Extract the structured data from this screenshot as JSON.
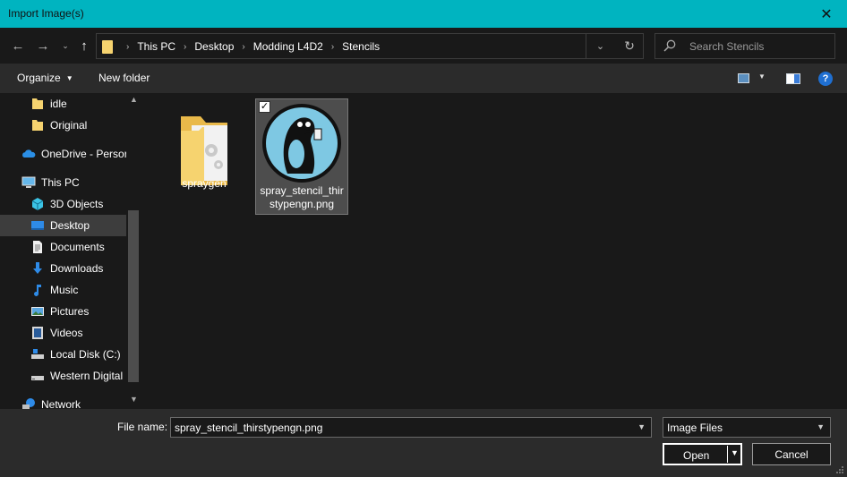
{
  "window": {
    "title": "Import Image(s)"
  },
  "address": {
    "crumbs": [
      "This PC",
      "Desktop",
      "Modding L4D2",
      "Stencils"
    ]
  },
  "search": {
    "placeholder": "Search Stencils"
  },
  "toolbar": {
    "organize_label": "Organize",
    "new_folder_label": "New folder"
  },
  "sidebar": {
    "items": [
      {
        "label": "idle",
        "icon": "folder-icon"
      },
      {
        "label": "Original",
        "icon": "folder-icon"
      },
      {
        "label": "OneDrive - Persor",
        "icon": "onedrive-icon"
      },
      {
        "label": "This PC",
        "icon": "this-pc-icon"
      },
      {
        "label": "3D Objects",
        "icon": "3d-objects-icon"
      },
      {
        "label": "Desktop",
        "icon": "desktop-icon",
        "selected": true
      },
      {
        "label": "Documents",
        "icon": "documents-icon"
      },
      {
        "label": "Downloads",
        "icon": "downloads-icon"
      },
      {
        "label": "Music",
        "icon": "music-icon"
      },
      {
        "label": "Pictures",
        "icon": "pictures-icon"
      },
      {
        "label": "Videos",
        "icon": "videos-icon"
      },
      {
        "label": "Local Disk (C:)",
        "icon": "local-disk-icon"
      },
      {
        "label": "Western Digital (",
        "icon": "drive-icon"
      },
      {
        "label": "Network",
        "icon": "network-icon"
      }
    ]
  },
  "files": [
    {
      "name": "spraygen",
      "type": "folder"
    },
    {
      "name_line1": "spray_stencil_thir",
      "name_line2": "stypengn.png",
      "type": "image",
      "selected": true,
      "checked": true
    }
  ],
  "footer": {
    "file_name_label": "File name:",
    "file_name_value": "spray_stencil_thirstypengn.png",
    "file_type_value": "Image Files",
    "open_label": "Open",
    "cancel_label": "Cancel"
  },
  "colors": {
    "titlebar": "#00b4c0",
    "folder": "#f6d36f",
    "selection": "#3d3d3d",
    "accent_blue": "#1f6fd1"
  }
}
